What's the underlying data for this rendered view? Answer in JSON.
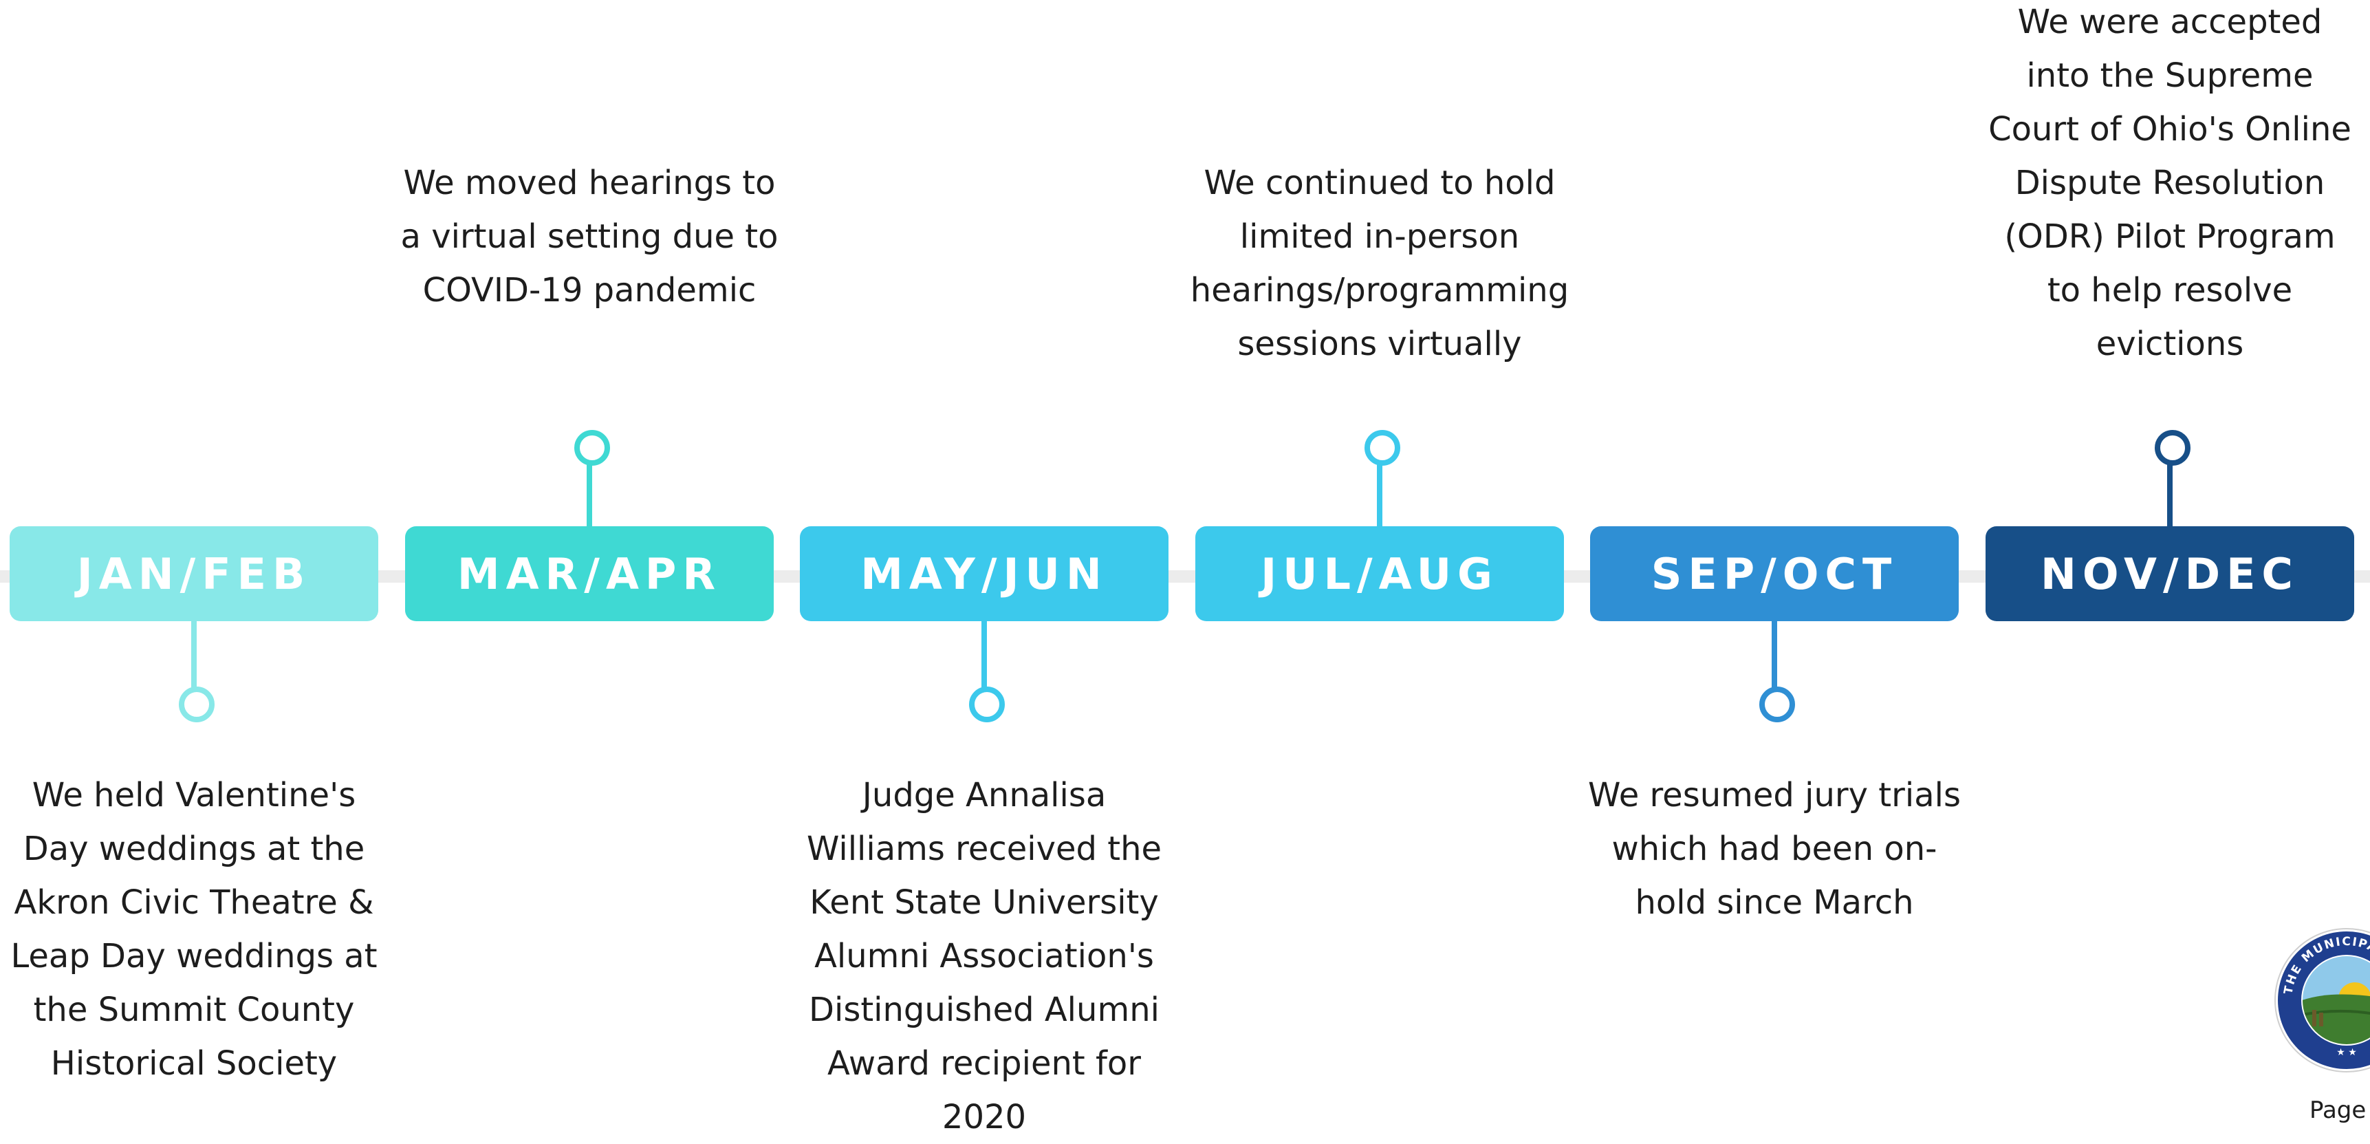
{
  "timeline": [
    {
      "label": "JAN/FEB",
      "color": "#88e8e8",
      "note_position": "below",
      "note_lines": [
        "We held Valentine's",
        "Day weddings at the",
        "Akron Civic Theatre &",
        "Leap Day weddings at",
        "the Summit County",
        "Historical Society"
      ]
    },
    {
      "label": "MAR/APR",
      "color": "#3fd9d3",
      "note_position": "above",
      "note_lines": [
        "We moved hearings to",
        "a virtual setting due to",
        "COVID-19 pandemic"
      ]
    },
    {
      "label": "MAY/JUN",
      "color": "#3cc9ec",
      "note_position": "below",
      "note_lines": [
        "Judge Annalisa",
        "Williams received the",
        "Kent State University",
        "Alumni Association's",
        "Distinguished Alumni",
        "Award recipient for",
        "2020"
      ]
    },
    {
      "label": "JUL/AUG",
      "color": "#3cc9ec",
      "note_position": "above",
      "note_lines": [
        "We continued to hold",
        "limited in-person",
        "hearings/programming",
        "sessions virtually"
      ]
    },
    {
      "label": "SEP/OCT",
      "color": "#2f8fd4",
      "note_position": "below",
      "note_lines": [
        "We resumed jury trials",
        "which had been on-",
        "hold since March"
      ]
    },
    {
      "label": "NOV/DEC",
      "color": "#174f88",
      "note_position": "above",
      "note_lines": [
        "We were accepted",
        "into the Supreme",
        "Court of Ohio's Online",
        "Dispute Resolution",
        "(ODR) Pilot Program",
        "to help resolve",
        "evictions"
      ]
    }
  ],
  "seal": {
    "arc_text": "THE MUNICIPAL COURT",
    "stars": "★ ★",
    "ring_color": "#1f3f8f",
    "sun_color": "#f4c51c"
  },
  "footer": {
    "page_label": "Page"
  }
}
